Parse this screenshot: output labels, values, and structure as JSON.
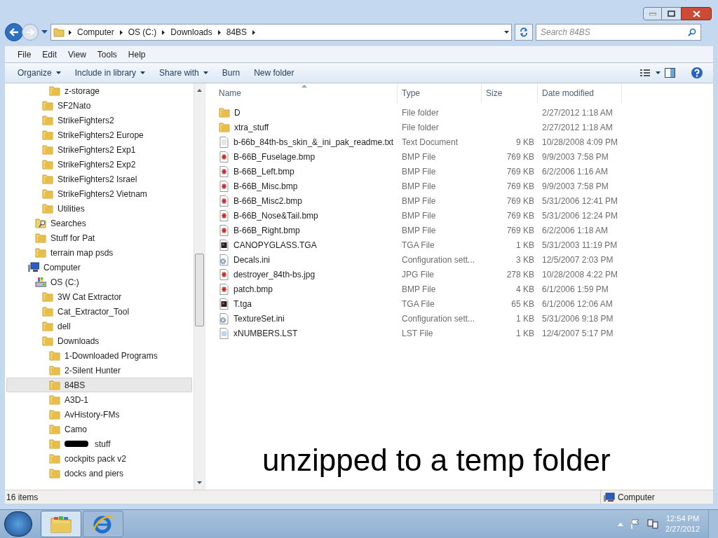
{
  "address_bar": {
    "segments": [
      "Computer",
      "OS (C:)",
      "Downloads",
      "84BS"
    ]
  },
  "search": {
    "placeholder": "Search 84BS"
  },
  "menu": [
    "File",
    "Edit",
    "View",
    "Tools",
    "Help"
  ],
  "toolbar": [
    {
      "label": "Organize",
      "dropdown": true
    },
    {
      "label": "Include in library",
      "dropdown": true
    },
    {
      "label": "Share with",
      "dropdown": true
    },
    {
      "label": "Burn",
      "dropdown": false
    },
    {
      "label": "New folder",
      "dropdown": false
    }
  ],
  "nav_tree": [
    {
      "children": [
        {
          "children": [
            {
              "children": [
                {
                  "label": "z-storage",
                  "kind": "folder",
                  "selected": false
                }
              ]
            },
            {
              "label": "SF2Nato",
              "kind": "folder",
              "selected": false
            },
            {
              "label": "StrikeFighters2",
              "kind": "folder",
              "selected": false
            },
            {
              "label": "StrikeFighters2 Europe",
              "kind": "folder",
              "selected": false
            },
            {
              "label": "StrikeFighters2 Exp1",
              "kind": "folder",
              "selected": false
            },
            {
              "label": "StrikeFighters2 Exp2",
              "kind": "folder",
              "selected": false
            },
            {
              "label": "StrikeFighters2 Israel",
              "kind": "folder",
              "selected": false
            },
            {
              "label": "StrikeFighters2 Vietnam",
              "kind": "folder",
              "selected": false
            },
            {
              "label": "Utilities",
              "kind": "folder",
              "selected": false
            }
          ]
        },
        {
          "label": "Searches",
          "kind": "search",
          "selected": false
        },
        {
          "label": "Stuff for Pat",
          "kind": "folder",
          "selected": false
        },
        {
          "label": "terrain map psds",
          "kind": "folder",
          "selected": false
        }
      ]
    },
    {
      "label": "Computer",
      "kind": "computer",
      "selected": false,
      "children": [
        {
          "label": "OS (C:)",
          "kind": "drive",
          "selected": false,
          "children": [
            {
              "label": "3W Cat Extractor",
              "kind": "folder",
              "selected": false
            },
            {
              "label": "Cat_Extractor_Tool",
              "kind": "folder",
              "selected": false
            },
            {
              "label": "dell",
              "kind": "folder",
              "selected": false
            },
            {
              "label": "Downloads",
              "kind": "folder",
              "selected": false,
              "children": [
                {
                  "label": "1-Downloaded Programs",
                  "kind": "folder",
                  "selected": false
                },
                {
                  "label": "2-Silent Hunter",
                  "kind": "folder",
                  "selected": false
                },
                {
                  "label": "84BS",
                  "kind": "folder",
                  "selected": true
                },
                {
                  "label": "A3D-1",
                  "kind": "folder",
                  "selected": false
                },
                {
                  "label": "AvHistory-FMs",
                  "kind": "folder",
                  "selected": false
                },
                {
                  "label": "Camo",
                  "kind": "folder",
                  "selected": false
                },
                {
                  "label": "stuff",
                  "kind": "folder",
                  "selected": false,
                  "redacted": true
                },
                {
                  "label": "cockpits pack v2",
                  "kind": "folder",
                  "selected": false
                },
                {
                  "label": "docks and piers",
                  "kind": "folder",
                  "selected": false
                }
              ]
            }
          ]
        }
      ]
    }
  ],
  "file_list": {
    "columns": [
      {
        "label": "Name",
        "sorted": true
      },
      {
        "label": "Type",
        "sorted": false
      },
      {
        "label": "Size",
        "sorted": false
      },
      {
        "label": "Date modified",
        "sorted": false
      }
    ],
    "rows": [
      {
        "name": "D",
        "kind": "folder",
        "type": "File folder",
        "date": "2/27/2012 1:18 AM"
      },
      {
        "name": "xtra_stuff",
        "kind": "folder",
        "type": "File folder",
        "date": "2/27/2012 1:18 AM"
      },
      {
        "name": "b-66b_84th-bs_skin_&_ini_pak_readme.txt",
        "kind": "text",
        "type": "Text Document",
        "size": "9 KB",
        "date": "10/28/2008 4:09 PM"
      },
      {
        "name": "B-66B_Fuselage.bmp",
        "kind": "image",
        "type": "BMP File",
        "size": "769 KB",
        "date": "9/9/2003 7:58 PM"
      },
      {
        "name": "B-66B_Left.bmp",
        "kind": "image",
        "type": "BMP File",
        "size": "769 KB",
        "date": "6/2/2006 1:16 AM"
      },
      {
        "name": "B-66B_Misc.bmp",
        "kind": "image",
        "type": "BMP File",
        "size": "769 KB",
        "date": "9/9/2003 7:58 PM"
      },
      {
        "name": "B-66B_Misc2.bmp",
        "kind": "image",
        "type": "BMP File",
        "size": "769 KB",
        "date": "5/31/2006 12:41 PM"
      },
      {
        "name": "B-66B_Nose&Tail.bmp",
        "kind": "image",
        "type": "BMP File",
        "size": "769 KB",
        "date": "5/31/2006 12:24 PM"
      },
      {
        "name": "B-66B_Right.bmp",
        "kind": "image",
        "type": "BMP File",
        "size": "769 KB",
        "date": "6/2/2006 1:18 AM"
      },
      {
        "name": "CANOPYGLASS.TGA",
        "kind": "tga",
        "type": "TGA File",
        "size": "1 KB",
        "date": "5/31/2003 11:19 PM"
      },
      {
        "name": "Decals.ini",
        "kind": "config",
        "type": "Configuration sett...",
        "size": "3 KB",
        "date": "12/5/2007 2:03 PM"
      },
      {
        "name": "destroyer_84th-bs.jpg",
        "kind": "image",
        "type": "JPG File",
        "size": "278 KB",
        "date": "10/28/2008 4:22 PM"
      },
      {
        "name": "patch.bmp",
        "kind": "image",
        "type": "BMP File",
        "size": "4 KB",
        "date": "6/1/2006 1:59 PM"
      },
      {
        "name": "T.tga",
        "kind": "tga",
        "type": "TGA File",
        "size": "65 KB",
        "date": "6/1/2006 12:06 AM"
      },
      {
        "name": "TextureSet.ini",
        "kind": "config",
        "type": "Configuration sett...",
        "size": "1 KB",
        "date": "5/31/2006 9:18 PM"
      },
      {
        "name": "xNUMBERS.LST",
        "kind": "list",
        "type": "LST File",
        "size": "1 KB",
        "date": "12/4/2007 5:17 PM"
      }
    ]
  },
  "annotation": "unzipped to a temp folder",
  "status_bar": {
    "item_count": "16 items",
    "location": "Computer"
  },
  "taskbar": {
    "buttons": [
      {
        "kind": "explorer",
        "active": true
      },
      {
        "kind": "browser",
        "active": false
      }
    ],
    "time": "12:54 PM",
    "date": "2/27/2012"
  }
}
